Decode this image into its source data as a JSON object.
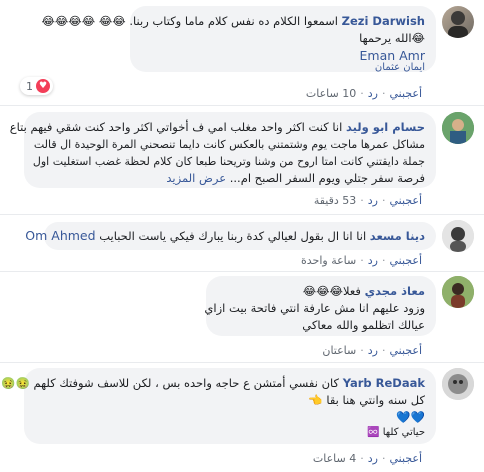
{
  "comments": [
    {
      "author": "Zezi Darwish",
      "lines": [
        "اسمعوا الكلام ده نفس كلام ماما وكتاب ربنا. 😂😂 😂😂😂😂",
        "😂الله يرحمها"
      ],
      "mention_1": "Eman Amr",
      "mention_2": "ايمان عثمان",
      "reaction_count": "1",
      "reaction_icon": "heart-icon",
      "actions": {
        "like": "أعجبني",
        "reply": "رد",
        "time": "10 ساعات"
      }
    },
    {
      "author": "حسام ابو وليد",
      "lines": [
        "انا كنت اكثر واحد مغلب امي ف أخواتي اكثر واحد كنت شقي فيهم بتاع",
        "مشاكل عمرها ماجت يوم وشتمتني بالعكس كانت دايما تنصحني المرة الوحيدة ال قالت",
        "جملة دايقتني كانت امتا اروح من وشنا وتريحنا طبعا كان كلام لحظة غضب استغليت اول",
        "فرصة سفر جتلي ويوم السفر الصبح ام... عرض المزيد"
      ],
      "see_more": "عرض المزيد",
      "actions": {
        "like": "أعجبني",
        "reply": "رد",
        "time": "53 دقيقة"
      }
    },
    {
      "author": "دينا مسعد",
      "lines": [
        "انا انا ال بقول لعيالي كدة ربنا يبارك فيكي ياست الحبايب"
      ],
      "mention": "Om Ahmed",
      "actions": {
        "like": "أعجبني",
        "reply": "رد",
        "time": "ساعة واحدة"
      }
    },
    {
      "author": "معاذ مجدي",
      "lines": [
        "فعلا😂😂😂",
        "وزود عليهم انا مش عارفة انتي فاتحة بيت ازاي",
        "عيالك اتظلمو والله معاكي"
      ],
      "actions": {
        "like": "أعجبني",
        "reply": "رد",
        "time": "ساعتان"
      }
    },
    {
      "author": "Yarb ReDaak",
      "lines": [
        "كان نفسي أمتشن ع حاجه واحده بس ، لكن للاسف شوفتك كلهم 🤢🤢",
        "كل سنه وانتي هنا بقا 👈",
        "💙💙",
        "حياتي كلها ♾️"
      ],
      "actions": {
        "like": "أعجبني",
        "reply": "رد",
        "time": "4 ساعات"
      }
    }
  ],
  "colors": {
    "link": "#385898",
    "bubble": "#f2f3f5",
    "text": "#1c1e21",
    "meta": "#606770"
  }
}
